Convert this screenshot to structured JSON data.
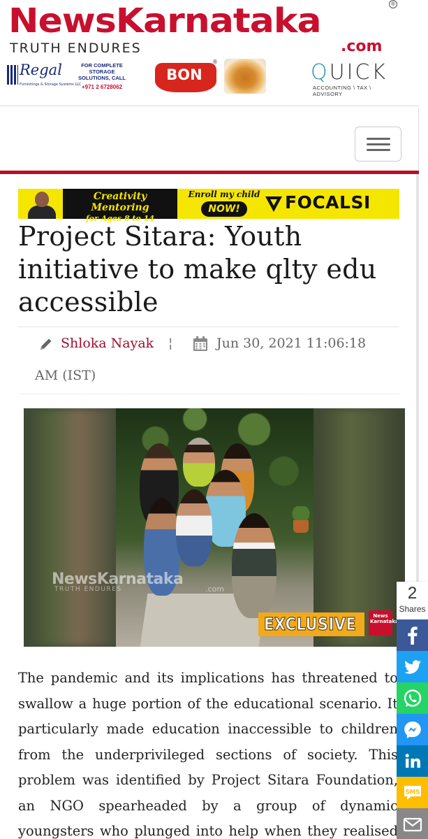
{
  "header": {
    "logo_text": "NewsKarnataka",
    "logo_tagline": "TRUTH ENDURES",
    "logo_domain": ".com",
    "logo_registered": "®"
  },
  "sponsors": {
    "regal": {
      "name": "Regal",
      "sub": "Furnishings & Storage Systems LLC",
      "offer": "FOR COMPLETE STORAGE SOLUTIONS, CALL",
      "phone": "+971 2 6728062"
    },
    "bon": {
      "name": "BON",
      "registered": "®"
    },
    "quick": {
      "name": "QUICK",
      "sub": "ACCOUNTING \\ TAX \\ ADVISORY"
    }
  },
  "nav": {
    "menu_label": "Toggle navigation"
  },
  "ad_banner": {
    "headline": "Creativity Mentoring",
    "subline": "for Ages 8 to 14",
    "cta_text": "Enroll my child",
    "cta_button": "NOW!",
    "brand": "FOCALSI"
  },
  "article": {
    "title": "Project Sitara: Youth initiative to make qlty edu accessible",
    "author": "Shloka Nayak",
    "separator": "¦",
    "date_line1": "Jun 30, 2021 11:06:18",
    "date_line2": "AM (IST)",
    "photo": {
      "watermark": "NewsKarnataka",
      "watermark_tagline": "TRUTH ENDURES",
      "watermark_domain": ".com",
      "badge": "EXCLUSIVE",
      "badge_logo": "News Karnataka"
    },
    "body_lines": [
      "The pandemic and its implications has threatened to",
      "swallow a huge portion of the educational scenario. It",
      "particularly made education inaccessible to children",
      "from the underprivileged sections of society. This",
      "problem was identified by Project Sitara Foundation,",
      "an NGO spearheaded by a group of dynamic",
      "youngsters who plunged into help when they realised"
    ]
  },
  "share": {
    "count": "2",
    "label": "Shares",
    "buttons": [
      {
        "name": "facebook",
        "color": "#3b5998"
      },
      {
        "name": "twitter",
        "color": "#1da1f2"
      },
      {
        "name": "whatsapp",
        "color": "#25d366"
      },
      {
        "name": "messenger",
        "color": "#2196f3"
      },
      {
        "name": "linkedin",
        "color": "#0077b5"
      },
      {
        "name": "sms",
        "color": "#ffbd00",
        "label": "SMS"
      },
      {
        "name": "email",
        "color": "#888888"
      }
    ]
  }
}
